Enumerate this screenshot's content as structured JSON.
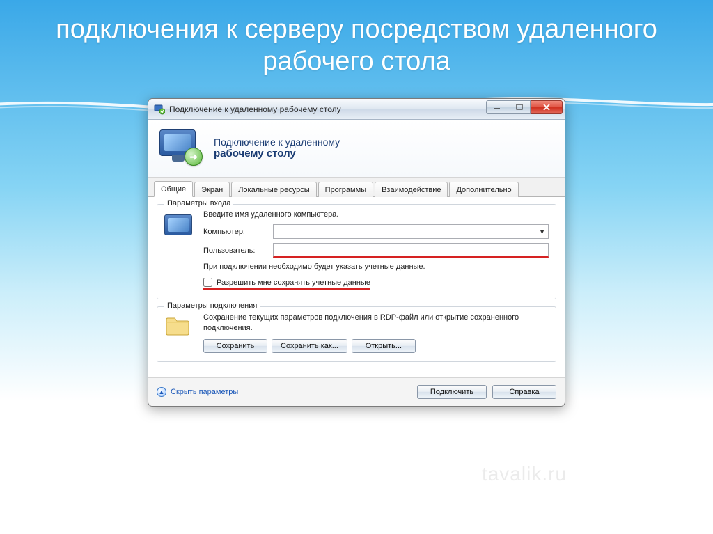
{
  "slide": {
    "title": "подключения к серверу посредством удаленного рабочего стола"
  },
  "window": {
    "title": "Подключение к удаленному рабочему столу"
  },
  "header": {
    "line1": "Подключение к удаленному",
    "line2": "рабочему столу"
  },
  "tabs": [
    "Общие",
    "Экран",
    "Локальные ресурсы",
    "Программы",
    "Взаимодействие",
    "Дополнительно"
  ],
  "login_group": {
    "legend": "Параметры входа",
    "instruction": "Введите имя удаленного компьютера.",
    "computer_label": "Компьютер:",
    "computer_value": "",
    "user_label": "Пользователь:",
    "user_value": "",
    "note": "При подключении необходимо будет указать учетные данные.",
    "checkbox_label": "Разрешить мне сохранять учетные данные"
  },
  "conn_group": {
    "legend": "Параметры подключения",
    "note": "Сохранение текущих параметров подключения в RDP-файл или открытие сохраненного подключения.",
    "save": "Сохранить",
    "save_as": "Сохранить как...",
    "open": "Открыть..."
  },
  "footer": {
    "hide_params": "Скрыть параметры",
    "connect": "Подключить",
    "help": "Справка"
  },
  "watermark": "tavalik.ru"
}
